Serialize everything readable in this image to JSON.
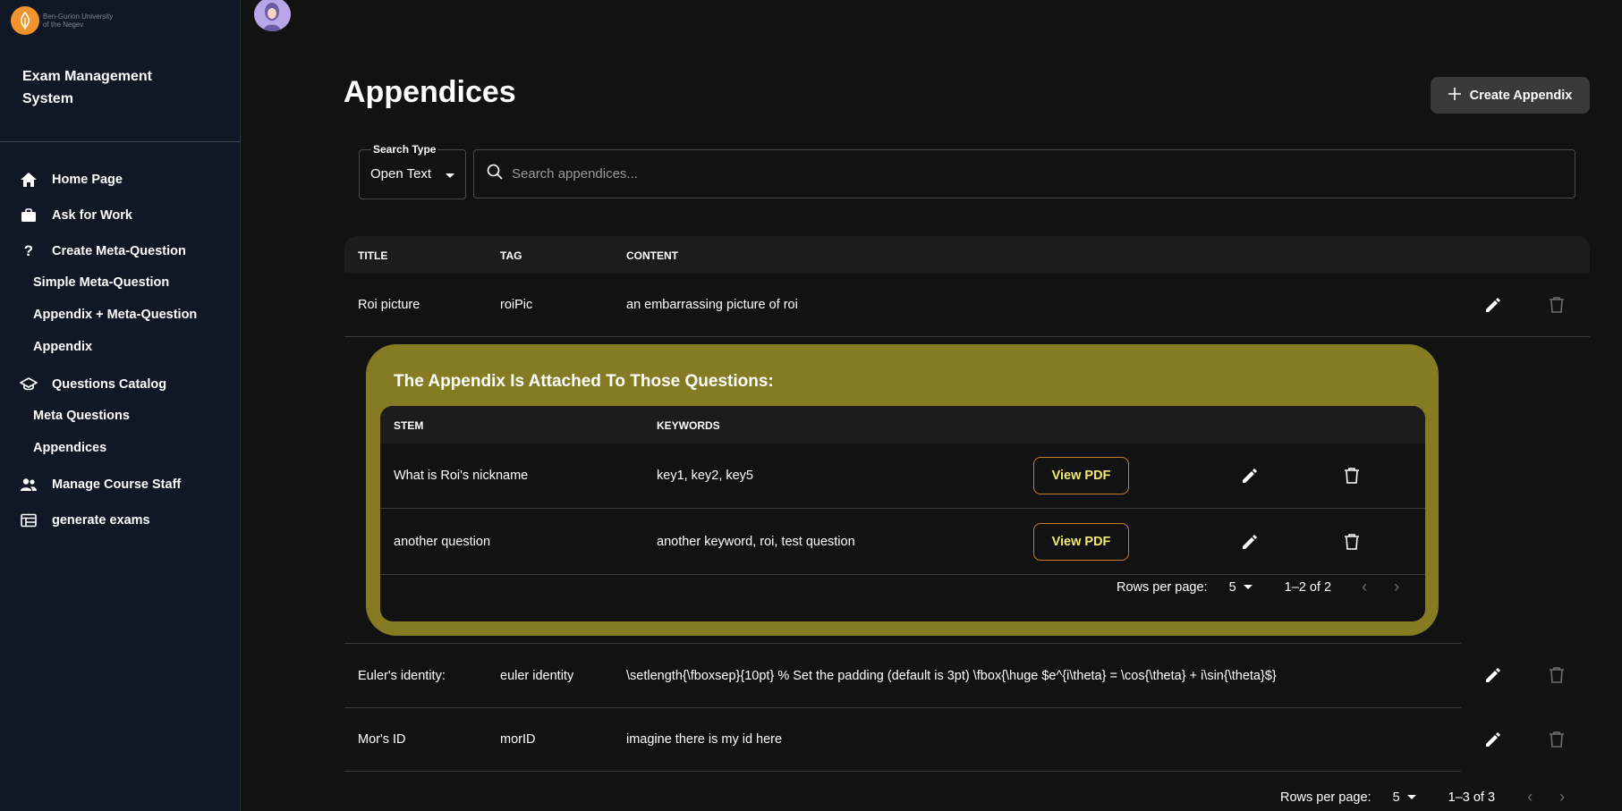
{
  "logo": {
    "line1": "Ben-Gurion University",
    "line2": "of the Negev",
    "icon": "bgu-logo-icon",
    "color": "#f0942b"
  },
  "app": {
    "title": "Exam Management System"
  },
  "sidebar": {
    "items": [
      {
        "label": "Home Page",
        "icon": "home-icon"
      },
      {
        "label": "Ask for Work",
        "icon": "briefcase-icon"
      },
      {
        "label": "Create Meta-Question",
        "icon": "question-mark-icon"
      },
      {
        "label": "Simple Meta-Question"
      },
      {
        "label": "Appendix + Meta-Question"
      },
      {
        "label": "Appendix"
      },
      {
        "label": "Questions Catalog",
        "icon": "graduation-cap-icon"
      },
      {
        "label": "Meta Questions"
      },
      {
        "label": "Appendices"
      },
      {
        "label": "Manage Course Staff",
        "icon": "people-icon"
      },
      {
        "label": "generate exams",
        "icon": "calendar-view-icon"
      }
    ]
  },
  "page": {
    "title": "Appendices",
    "create_label": "Create Appendix"
  },
  "search": {
    "type_label": "Search Type",
    "type_value": "Open Text",
    "placeholder": "Search appendices..."
  },
  "table": {
    "headers": [
      "TITLE",
      "TAG",
      "CONTENT"
    ],
    "rows": [
      {
        "title": "Roi picture",
        "tag": "roiPic",
        "content": "an embarrassing picture of roi"
      },
      {
        "title": "Euler's identity:",
        "tag": "euler identity",
        "content": "\\setlength{\\fboxsep}{10pt} % Set the padding (default is 3pt) \\fbox{\\huge $e^{i\\theta} = \\cos{\\theta} + i\\sin{\\theta}$}"
      },
      {
        "title": "Mor's ID",
        "tag": "morID",
        "content": "imagine there is my id here"
      }
    ],
    "pager": {
      "rows_label": "Rows per page:",
      "rows_value": "5",
      "range": "1–3 of 3"
    }
  },
  "attached": {
    "title": "The Appendix Is Attached To Those Questions:",
    "accent": "#857b22",
    "headers": [
      "STEM",
      "KEYWORDS"
    ],
    "rows": [
      {
        "stem": "What is Roi's nickname",
        "keywords": "key1, key2, key5",
        "pdf_label": "View PDF"
      },
      {
        "stem": "another question",
        "keywords": "another keyword, roi, test question",
        "pdf_label": "View PDF"
      }
    ],
    "pager": {
      "rows_label": "Rows per page:",
      "rows_value": "5",
      "range": "1–2 of 2"
    }
  }
}
